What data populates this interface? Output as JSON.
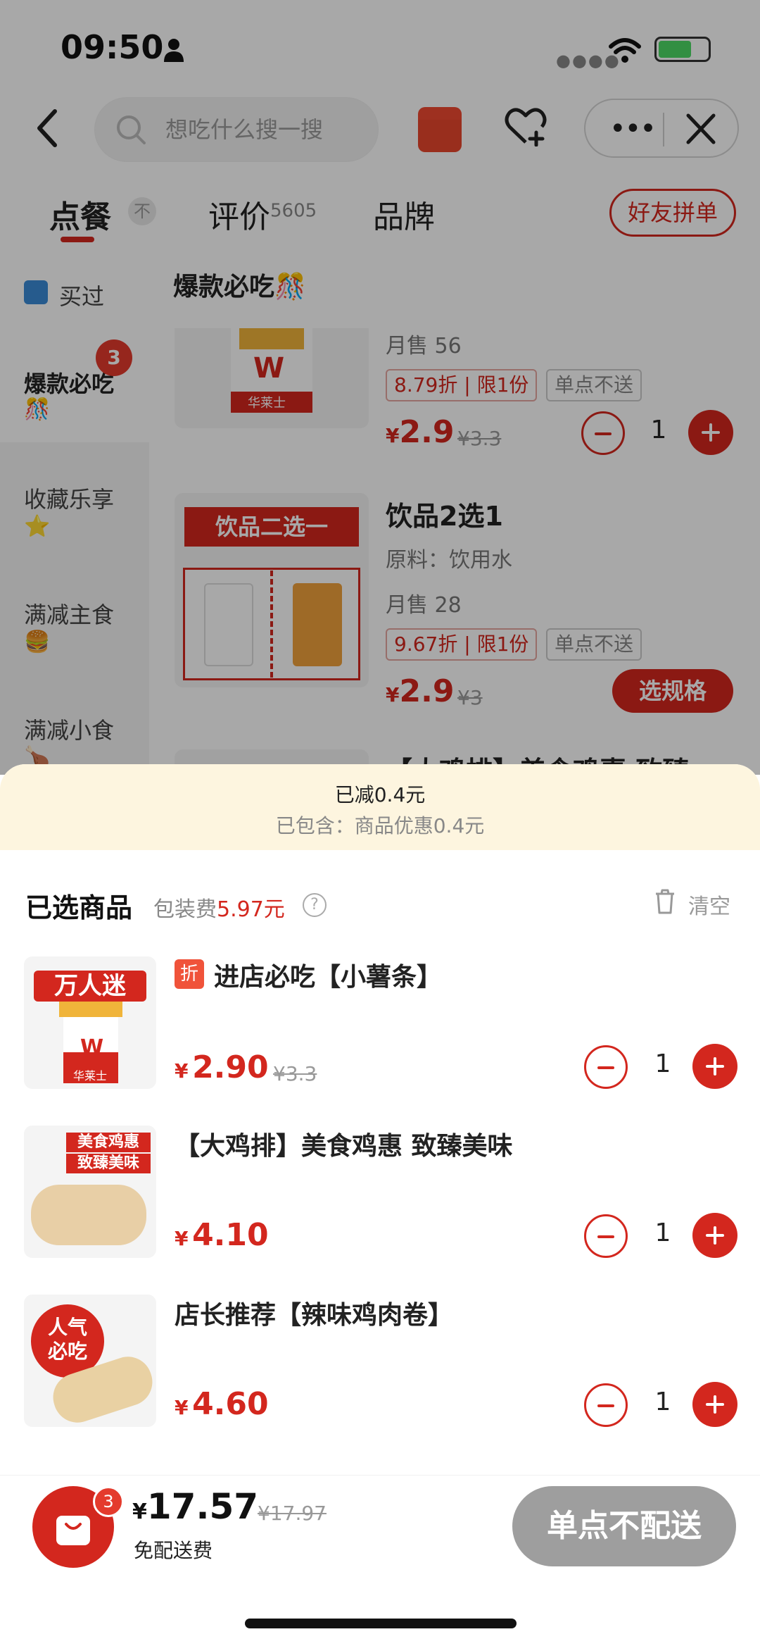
{
  "status_bar": {
    "time": "09:50"
  },
  "header": {
    "search_placeholder": "想吃什么搜一搜",
    "tabs": [
      {
        "label": "点餐",
        "active": true
      },
      {
        "label": "评价",
        "count": "5605"
      },
      {
        "label": "品牌"
      }
    ],
    "pin_glyph": "不",
    "friend_order_button": "好友拼单"
  },
  "sidebar": {
    "items": [
      {
        "label": "买过"
      },
      {
        "label": "爆款必吃",
        "badge": "3",
        "emoji": "🎊"
      },
      {
        "label": "收藏乐享",
        "emoji": "⭐"
      },
      {
        "label": "满减主食",
        "emoji": "🍔"
      },
      {
        "label": "满减小食",
        "emoji": "🍗"
      }
    ]
  },
  "menu": {
    "category_title": "爆款必吃",
    "category_emoji": "🎊",
    "items": [
      {
        "monthly_sales": "月售 56",
        "discount_tag": "8.79折",
        "limit_tag": "限1份",
        "delivery_tag": "单点不送",
        "price_symbol": "¥",
        "price": "2.9",
        "original_price": "¥3.3",
        "qty": "1",
        "image_brand": "华莱士"
      },
      {
        "title": "饮品2选1",
        "ingredients": "原料：饮用水",
        "monthly_sales": "月售 28",
        "discount_tag": "9.67折",
        "limit_tag": "限1份",
        "delivery_tag": "单点不送",
        "price_symbol": "¥",
        "price": "2.9",
        "original_price": "¥3",
        "spec_button": "选规格",
        "image_banner": "饮品二选一"
      },
      {
        "title": "【大鸡排】美食鸡惠 致臻"
      }
    ]
  },
  "cart_sheet": {
    "saved_line1": "已减0.4元",
    "saved_line2": "已包含：商品优惠0.4元",
    "title": "已选商品",
    "packing_fee_label": "包装费",
    "packing_fee": "5.97元",
    "help_glyph": "?",
    "clear_label": "清空",
    "items": [
      {
        "tag": "折",
        "name": "进店必吃【小薯条】",
        "price_symbol": "¥",
        "price": "2.90",
        "original_price": "¥3.3",
        "qty": "1",
        "image_text": "万人迷",
        "image_brand": "华莱士"
      },
      {
        "name": "【大鸡排】美食鸡惠 致臻美味",
        "price_symbol": "¥",
        "price": "4.10",
        "qty": "1",
        "image_text_1": "美食鸡惠",
        "image_text_2": "致臻美味"
      },
      {
        "name": "店长推荐【辣味鸡肉卷】",
        "price_symbol": "¥",
        "price": "4.60",
        "qty": "1",
        "image_text_1": "人气",
        "image_text_2": "必吃"
      }
    ]
  },
  "footer": {
    "cart_count": "3",
    "total_symbol": "¥",
    "total": "17.57",
    "original_total": "¥17.97",
    "delivery_note": "免配送费",
    "checkout_button": "单点不配送"
  },
  "colors": {
    "brand_red": "#d3271e",
    "saved_banner": "#fdf5df",
    "disabled_button": "#9e9e9e"
  }
}
